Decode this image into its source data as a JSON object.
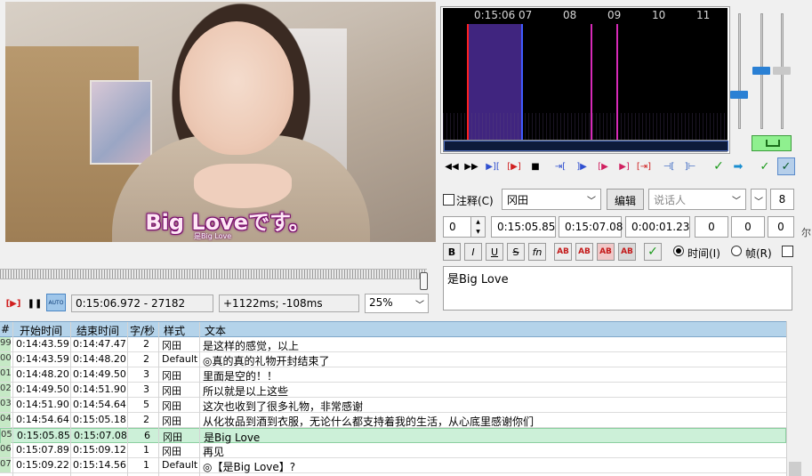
{
  "video": {
    "subtitle_main": "Big Loveです。",
    "subtitle_small": "是Big Love"
  },
  "playback": {
    "timecode": "0:15:06.972 - 27182",
    "offset": "+1122ms; -108ms",
    "zoom": "25%",
    "auto_label": "AUTO"
  },
  "audio": {
    "time_labels": [
      "0:15:06",
      "07",
      "08",
      "09",
      "10",
      "11"
    ],
    "auto_label": "AUTO"
  },
  "editor": {
    "comment_label": "注释(C)",
    "style": "冈田",
    "edit_label": "编辑",
    "actor_placeholder": "说话人",
    "layer": "8",
    "layer_value": "0",
    "start_time": "0:15:05.85",
    "end_time": "0:15:07.08",
    "duration": "0:00:01.23",
    "margin_l": "0",
    "margin_r": "0",
    "margin_v": "0",
    "format_buttons": [
      "B",
      "I",
      "U",
      "S",
      "fn"
    ],
    "time_radio_label": "时间(I)",
    "frame_radio_label": "帧(R)",
    "text": "是Big Love",
    "side_char": "尔"
  },
  "grid": {
    "headers": {
      "num": "#",
      "start": "开始时间",
      "end": "结束时间",
      "cps": "字/秒",
      "style": "样式",
      "text": "文本"
    },
    "rows": [
      {
        "num": "99",
        "start": "0:14:43.59",
        "end": "0:14:47.47",
        "cps": "2",
        "style": "冈田",
        "text": "是这样的感觉，以上"
      },
      {
        "num": "00",
        "start": "0:14:43.59",
        "end": "0:14:48.20",
        "cps": "2",
        "style": "Default",
        "text": "◎真的真的礼物开封结束了"
      },
      {
        "num": "01",
        "start": "0:14:48.20",
        "end": "0:14:49.50",
        "cps": "3",
        "style": "冈田",
        "text": "里面是空的！！"
      },
      {
        "num": "02",
        "start": "0:14:49.50",
        "end": "0:14:51.90",
        "cps": "3",
        "style": "冈田",
        "text": "所以就是以上这些"
      },
      {
        "num": "03",
        "start": "0:14:51.90",
        "end": "0:14:54.64",
        "cps": "5",
        "style": "冈田",
        "text": "这次也收到了很多礼物，非常感谢"
      },
      {
        "num": "04",
        "start": "0:14:54.64",
        "end": "0:15:05.18",
        "cps": "2",
        "style": "冈田",
        "text": "从化妆品到酒到衣服，无论什么都支持着我的生活，从心底里感谢你们"
      },
      {
        "num": "05",
        "start": "0:15:05.85",
        "end": "0:15:07.08",
        "cps": "6",
        "style": "冈田",
        "text": "是Big Love"
      },
      {
        "num": "06",
        "start": "0:15:07.89",
        "end": "0:15:09.12",
        "cps": "1",
        "style": "冈田",
        "text": "再见"
      },
      {
        "num": "07",
        "start": "0:15:09.22",
        "end": "0:15:14.56",
        "cps": "1",
        "style": "Default",
        "text": "◎【是Big Love】?"
      }
    ],
    "selected_index": 6
  }
}
